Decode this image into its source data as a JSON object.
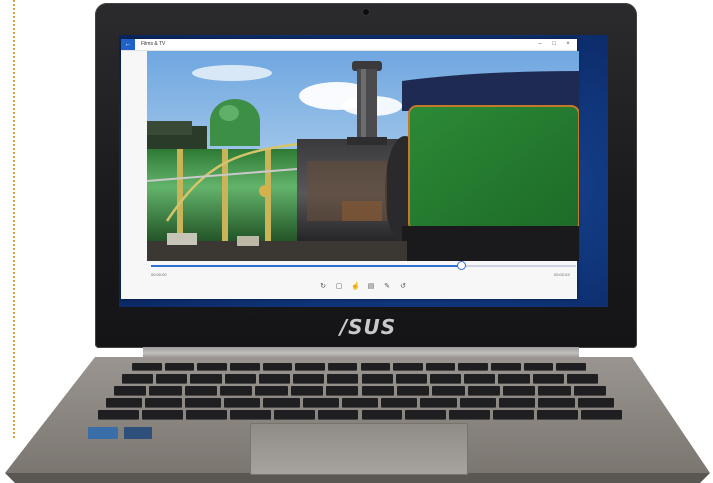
{
  "laptop": {
    "brand": "/SUS"
  },
  "app": {
    "back_label": "←",
    "window_title": "Films & TV",
    "controls": {
      "minimize": "–",
      "maximize": "□",
      "close": "×"
    }
  },
  "player": {
    "elapsed": "00:00:00",
    "remaining": "00:02:03",
    "progress": 0.73,
    "tools": [
      {
        "name": "rotate-icon",
        "glyph": "↻"
      },
      {
        "name": "crop-icon",
        "glyph": "▢"
      },
      {
        "name": "touch-icon",
        "glyph": "☝"
      },
      {
        "name": "film-icon",
        "glyph": "▤"
      },
      {
        "name": "pen-icon",
        "glyph": "✎"
      },
      {
        "name": "refresh-icon",
        "glyph": "↺"
      }
    ]
  },
  "colors": {
    "accent": "#2a6fd1",
    "loco_green": "#2f8a3a",
    "loco_black": "#222225",
    "sky": "#8bbbe6"
  }
}
